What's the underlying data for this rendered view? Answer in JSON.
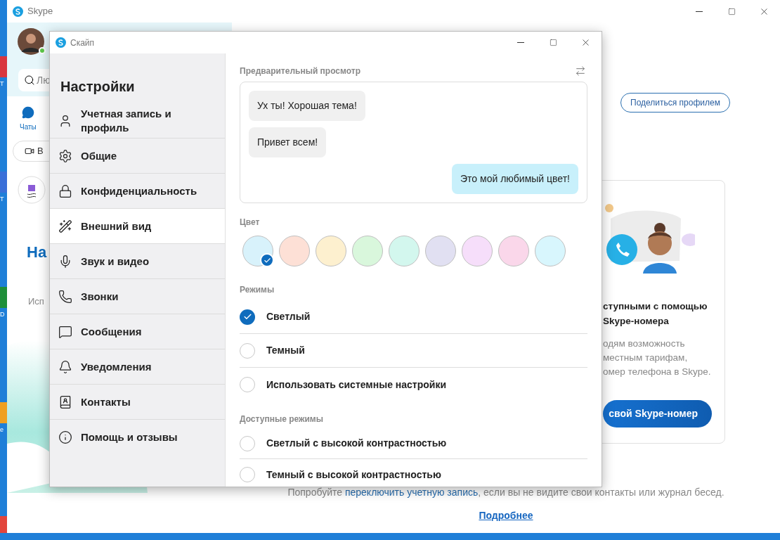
{
  "desktop": {
    "icons": [
      {
        "label": "T",
        "color": "#d9363e"
      },
      {
        "label": "T",
        "color": "#3a6fd8"
      },
      {
        "label": "D",
        "color": "#1f8f3a"
      },
      {
        "label": "e",
        "color": "#f0a020"
      }
    ]
  },
  "main_window": {
    "title": "Skype",
    "sidebar": {
      "search": {
        "value": "Лю"
      },
      "tabs": [
        {
          "label": "Чаты",
          "selected": true
        }
      ],
      "meet_button": {
        "label": "В"
      },
      "heading": "На",
      "subtitle": "Исп",
      "status": {
        "online": true
      }
    },
    "share_button": "Поделиться профилем",
    "promo_card": {
      "title_lines": [
        "ступными с помощью",
        "Skype-номера"
      ],
      "body_lines": [
        "одям возможность",
        "местным тарифам,",
        "омер телефона в Skype."
      ],
      "button": "свой Skype-номер"
    },
    "footer": {
      "text_before": "Попробуйте",
      "link": "переключить учетную запись",
      "text_after": ", если вы не видите свои контакты или журнал бесед.",
      "more_link": "Подробнее"
    }
  },
  "settings_window": {
    "title": "Скайп",
    "heading": "Настройки",
    "nav": [
      {
        "label": "Учетная запись и профиль",
        "selected": false
      },
      {
        "label": "Общие",
        "selected": false
      },
      {
        "label": "Конфиденциальность",
        "selected": false
      },
      {
        "label": "Внешний вид",
        "selected": true
      },
      {
        "label": "Звук и видео",
        "selected": false
      },
      {
        "label": "Звонки",
        "selected": false
      },
      {
        "label": "Сообщения",
        "selected": false
      },
      {
        "label": "Уведомления",
        "selected": false
      },
      {
        "label": "Контакты",
        "selected": false
      },
      {
        "label": "Помощь и отзывы",
        "selected": false
      }
    ],
    "preview": {
      "label": "Предварительный просмотр",
      "messages": [
        {
          "text": "Ух ты! Хорошая тема!",
          "kind": "incoming"
        },
        {
          "text": "Привет всем!",
          "kind": "incoming"
        },
        {
          "text": "Это мой любимый цвет!",
          "kind": "outgoing"
        }
      ]
    },
    "color_label": "Цвет",
    "colors": [
      {
        "color": "#d8f2fb",
        "selected": true
      },
      {
        "color": "#fde0d6",
        "selected": false
      },
      {
        "color": "#fdf0cf",
        "selected": false
      },
      {
        "color": "#d9f7dc",
        "selected": false
      },
      {
        "color": "#d3f7ee",
        "selected": false
      },
      {
        "color": "#e1e0f2",
        "selected": false
      },
      {
        "color": "#f6defa",
        "selected": false
      },
      {
        "color": "#fad7ea",
        "selected": false
      },
      {
        "color": "#d8f6fd",
        "selected": false
      }
    ],
    "modes_label": "Режимы",
    "modes": [
      {
        "label": "Светлый",
        "selected": true
      },
      {
        "label": "Темный",
        "selected": false
      },
      {
        "label": "Использовать системные настройки",
        "selected": false
      }
    ],
    "accessible_label": "Доступные режимы",
    "accessible_modes": [
      {
        "label": "Светлый с высокой контрастностью",
        "selected": false
      },
      {
        "label": "Темный с высокой контрастностью",
        "selected": false
      }
    ]
  }
}
